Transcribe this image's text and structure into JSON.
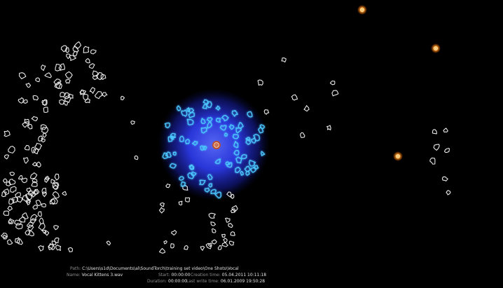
{
  "view": {
    "background": "#000000",
    "focus_glow_color": "#2a36ff",
    "selected_sample_color": "#4bc6ff",
    "default_sample_color": "#e8e8e8",
    "highlight_sample_color": "#ff8a1c",
    "center_marker_color": "#ff6a2a"
  },
  "info": {
    "path_label": "Path:",
    "path_value": "C:\\Users\\s1d\\Documents\\al\\SoundTorch\\training set video\\One Shots\\Vocal",
    "name_label": "Name:",
    "name_value": "Vocal Kittens 3.wav",
    "start_label": "Start:",
    "start_value": "00:00:00",
    "duration_label": "Duration:",
    "duration_value": "00:00:00",
    "creation_label": "Creation time:",
    "creation_value": "05.04.2011 10:11:18",
    "write_label": "Last write time:",
    "write_value": "06.01.2009 19:50:28"
  }
}
